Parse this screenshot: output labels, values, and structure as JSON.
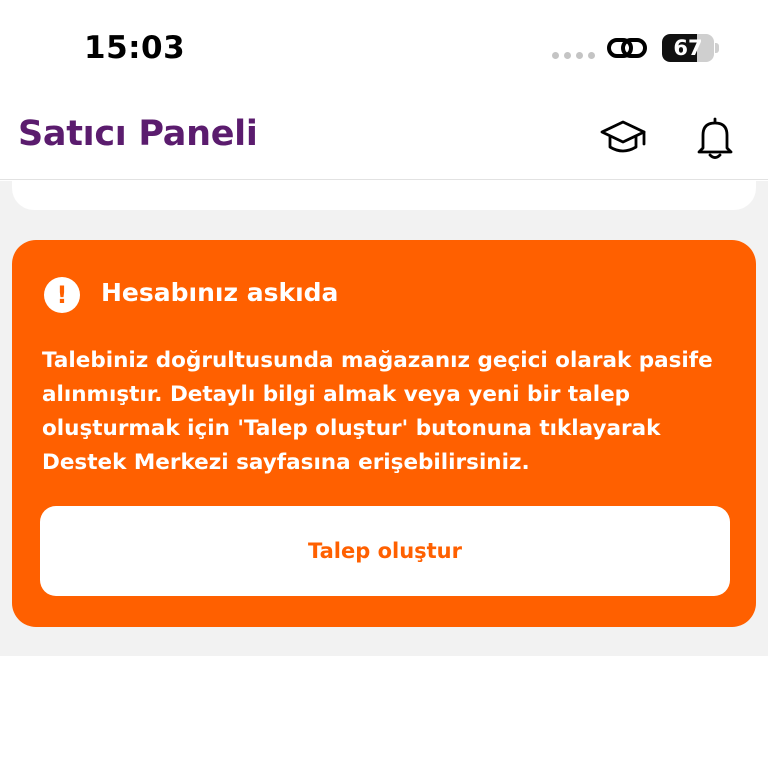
{
  "status_bar": {
    "time": "15:03",
    "battery_level": "67",
    "battery_fraction": 0.67
  },
  "header": {
    "title": "Satıcı Paneli",
    "icons": [
      "graduation-cap-icon",
      "bell-icon"
    ]
  },
  "alert": {
    "icon": "exclamation-icon",
    "title": "Hesabınız askıda",
    "body": "Talebiniz doğrultusunda mağazanız geçici olarak pasife alınmıştır. Detaylı bilgi almak veya yeni bir talep oluşturmak için 'Talep oluştur' butonuna tıklayarak Destek Merkezi sayfasına erişebilirsiniz.",
    "button_label": "Talep oluştur"
  },
  "colors": {
    "brand_purple": "#5b1c6e",
    "alert_orange": "#ff6000",
    "background_gray": "#f2f2f2"
  }
}
